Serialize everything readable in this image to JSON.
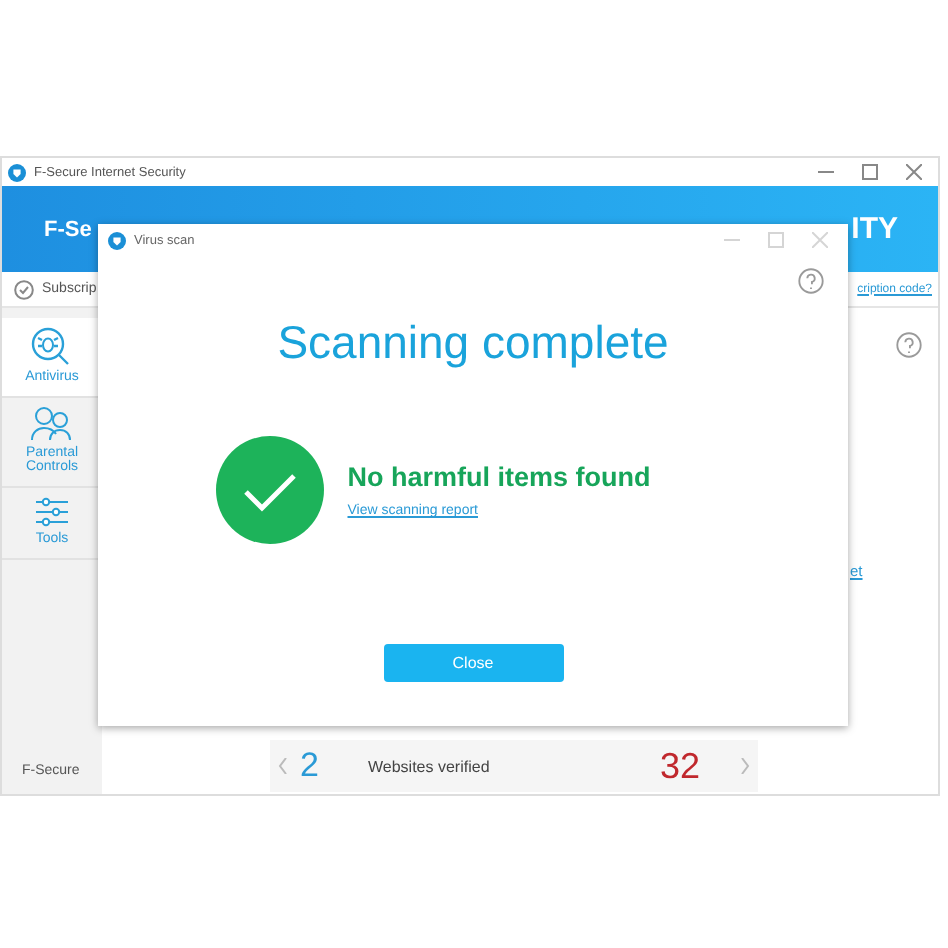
{
  "main_window": {
    "title": "F-Secure Internet Security",
    "header": {
      "brand": "F-Se",
      "product": "ITY"
    },
    "subscription": {
      "text": "Subscrip",
      "link": "cription code?"
    },
    "sidebar": {
      "items": [
        {
          "label": "Antivirus",
          "kind": "antivirus",
          "selected": true
        },
        {
          "label": "Parental Controls",
          "kind": "parental",
          "selected": false
        },
        {
          "label": "Tools",
          "kind": "tools",
          "selected": false
        }
      ],
      "footer": "F-Secure"
    },
    "content": {
      "link": "et",
      "stats_row": {
        "value": "2",
        "label": "Websites verified",
        "count": "32"
      }
    }
  },
  "dialog": {
    "title": "Virus scan",
    "heading": "Scanning complete",
    "result": "No harmful items found",
    "link": "View scanning report",
    "button": "Close"
  }
}
